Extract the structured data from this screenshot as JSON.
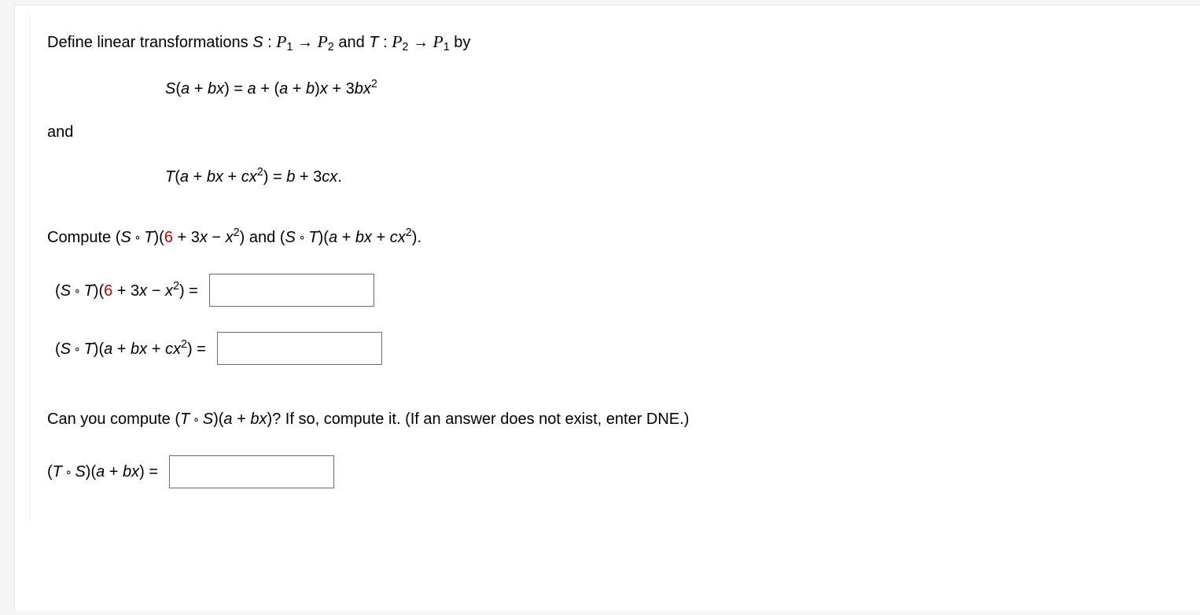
{
  "intro": {
    "pre": "Define linear transformations ",
    "S": "S",
    "colon": " : ",
    "P": "P",
    "sub1": "1",
    "arrow": " → ",
    "sub2": "2",
    "and_mid": " and ",
    "T": "T",
    "by": " by"
  },
  "defS": {
    "lhs_func": "S",
    "lhs_open": "(",
    "a": "a",
    "plus": " + ",
    "b": "b",
    "x": "x",
    "lhs_close": ")",
    "eq": " = ",
    "r_a": "a",
    "r_plus1": " + (",
    "r_a2": "a",
    "r_plus2": " + ",
    "r_b": "b",
    "r_close": ")",
    "r_x": "x",
    "r_plus3": " + 3",
    "r_b2": "b",
    "r_x2": "x",
    "r_sq": "2"
  },
  "and_word": "and",
  "defT": {
    "lhs_func": "T",
    "lhs_open": "(",
    "a": "a",
    "plus1": " + ",
    "b": "b",
    "x": "x",
    "plus2": " + ",
    "c": "c",
    "x2": "x",
    "sq": "2",
    "lhs_close": ")",
    "eq": " = ",
    "r_b": "b",
    "r_plus": " + 3",
    "r_c": "c",
    "r_x": "x",
    "dot": "."
  },
  "compute": {
    "pre": "Compute (",
    "S": "S",
    "compose": " ∘ ",
    "T": "T",
    "arg1_open": ")(",
    "six": "6",
    "plus1": " + 3",
    "x": "x",
    "minus": " − ",
    "x2": "x",
    "sq": "2",
    "arg1_close": ")",
    "and": " and (",
    "arg2_a": "a",
    "plus2": " + ",
    "arg2_b": "b",
    "plus3": " + ",
    "arg2_c": "c",
    "arg2_close": ")."
  },
  "ans1": {
    "open": "(",
    "S": "S",
    "compose": " ∘ ",
    "T": "T",
    "mid": ")(",
    "six": "6",
    "plus": " + 3",
    "x": "x",
    "minus": " − ",
    "x2": "x",
    "sq": "2",
    "close": ")  ="
  },
  "ans2": {
    "open": "(",
    "S": "S",
    "compose": " ∘ ",
    "T": "T",
    "mid": ")(",
    "a": "a",
    "plus1": " + ",
    "b": "b",
    "x": "x",
    "plus2": " + ",
    "c": "c",
    "x2": "x",
    "sq": "2",
    "close": ")  ="
  },
  "q2": {
    "pre": "Can you compute (",
    "T": "T",
    "compose": " ∘ ",
    "S": "S",
    "mid": ")(",
    "a": "a",
    "plus": " + ",
    "b": "b",
    "x": "x",
    "close": ")? If so, compute it. (If an answer does not exist, enter DNE.)"
  },
  "ans3": {
    "open": "(",
    "T": "T",
    "compose": " ∘ ",
    "S": "S",
    "mid": ")(",
    "a": "a",
    "plus": " + ",
    "b": "b",
    "x": "x",
    "close": ") ="
  }
}
